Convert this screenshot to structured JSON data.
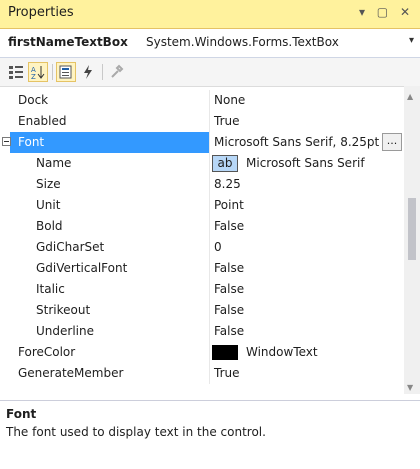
{
  "window": {
    "title": "Properties",
    "controls": "▾ ▢ ✕"
  },
  "object_selector": {
    "name": "firstNameTextBox",
    "type": "System.Windows.Forms.TextBox"
  },
  "toolbar": {
    "buttons": [
      "categorized-icon",
      "alphabetical-icon",
      "properties-icon",
      "events-icon",
      "property-pages-icon"
    ],
    "active": [
      "alphabetical-icon",
      "properties-icon"
    ]
  },
  "grid": {
    "rows": [
      {
        "name": "Dock",
        "value": "None",
        "indent": 0
      },
      {
        "name": "Enabled",
        "value": "True",
        "indent": 0
      },
      {
        "name": "Font",
        "value": "Microsoft Sans Serif, 8.25pt",
        "indent": 0,
        "expanded": true,
        "selected": true,
        "ellipsis": "..."
      },
      {
        "name": "Name",
        "value": "Microsoft Sans Serif",
        "indent": 1,
        "preview": "ab"
      },
      {
        "name": "Size",
        "value": "8.25",
        "indent": 1
      },
      {
        "name": "Unit",
        "value": "Point",
        "indent": 1
      },
      {
        "name": "Bold",
        "value": "False",
        "indent": 1
      },
      {
        "name": "GdiCharSet",
        "value": "0",
        "indent": 1
      },
      {
        "name": "GdiVerticalFont",
        "value": "False",
        "indent": 1
      },
      {
        "name": "Italic",
        "value": "False",
        "indent": 1
      },
      {
        "name": "Strikeout",
        "value": "False",
        "indent": 1
      },
      {
        "name": "Underline",
        "value": "False",
        "indent": 1
      },
      {
        "name": "ForeColor",
        "value": "WindowText",
        "indent": 0,
        "swatch": "#000000"
      },
      {
        "name": "GenerateMember",
        "value": "True",
        "indent": 0
      }
    ]
  },
  "description": {
    "title": "Font",
    "text": "The font used to display text in the control."
  },
  "colors": {
    "titlebar": "#fff29d",
    "selection": "#3399ff",
    "toolbar_active": "#fff4c2"
  }
}
